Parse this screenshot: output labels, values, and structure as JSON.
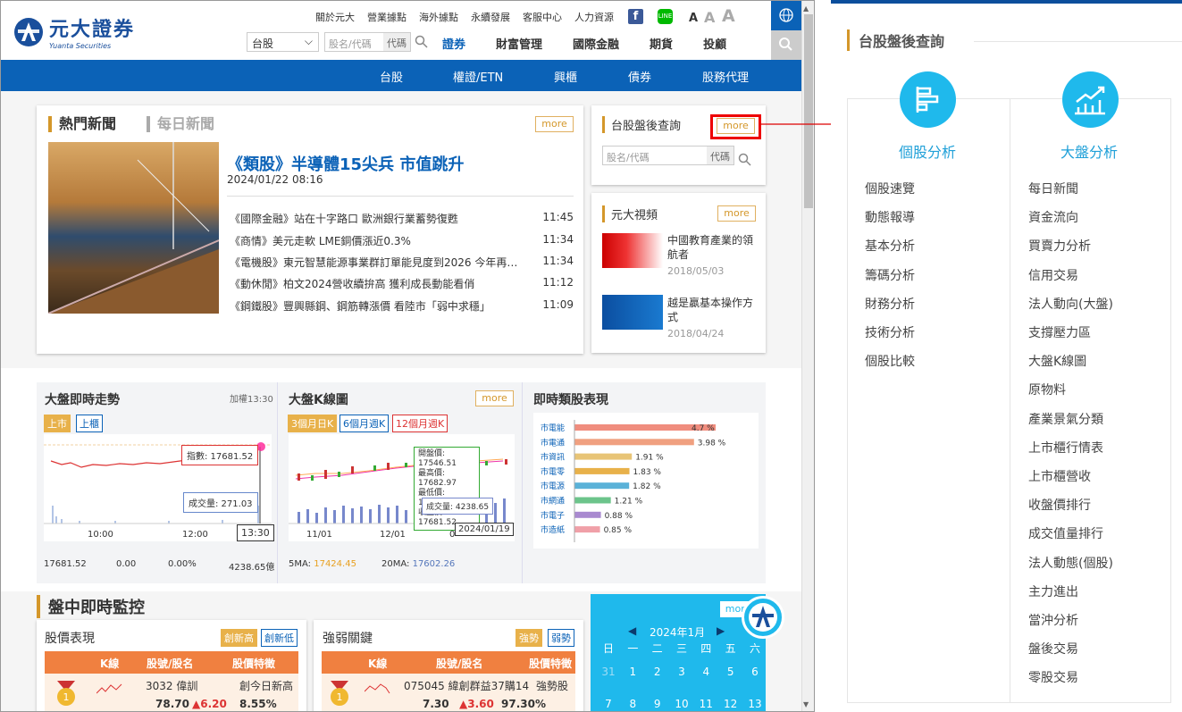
{
  "header": {
    "logo_cn": "元大證券",
    "logo_en": "Yuanta Securities",
    "top_links": [
      "關於元大",
      "營業據點",
      "海外據點",
      "永續發展",
      "客服中心",
      "人力資源"
    ],
    "font_sizes": [
      "A",
      "A",
      "A"
    ],
    "market_select": "台股",
    "search_placeholder": "股名/代碼",
    "search_code": "代碼",
    "main_nav": [
      "證券",
      "財富管理",
      "國際金融",
      "期貨",
      "投顧"
    ]
  },
  "subnav": [
    "台股",
    "權證/ETN",
    "興櫃",
    "債券",
    "股務代理"
  ],
  "news": {
    "tab_hot": "熱門新聞",
    "tab_daily": "每日新聞",
    "more": "more",
    "headline": "《類股》半導體15尖兵 市值跳升",
    "headline_date": "2024/01/22 08:16",
    "items": [
      {
        "t": "《國際金融》站在十字路口 歐洲銀行業蓄勢復甦",
        "time": "11:45"
      },
      {
        "t": "《商情》美元走軟 LME銅價漲近0.3%",
        "time": "11:34"
      },
      {
        "t": "《電機股》東元智慧能源事業群訂單能見度到2026 今年再…",
        "time": "11:34"
      },
      {
        "t": "《動休閒》柏文2024營收續拚高 獲利成長動能看俏",
        "time": "11:12"
      },
      {
        "t": "《鋼鐵股》豐興縣鋼、鋼筋轉漲價 看陸市「弱中求穩」",
        "time": "11:09"
      }
    ]
  },
  "after_hours": {
    "title": "台股盤後查詢",
    "more": "more",
    "placeholder": "股名/代碼",
    "code": "代碼"
  },
  "video": {
    "title": "元大視頻",
    "more": "more",
    "items": [
      {
        "t": "中國教育產業的領航者",
        "d": "2018/05/03"
      },
      {
        "t": "越是贏基本操作方式",
        "d": "2018/04/24"
      }
    ]
  },
  "market_trend": {
    "title": "大盤即時走勢",
    "time": "加權13:30",
    "tab1": "上市",
    "tab2": "上櫃",
    "index_label": "指數: 17681.52",
    "vol_label": "成交量: 271.03",
    "cursor_time": "13:30",
    "x1": "10:00",
    "x2": "12:00",
    "stats": [
      "17681.52",
      "0.00",
      "0.00%",
      "4238.65億"
    ]
  },
  "kline": {
    "title": "大盤K線圖",
    "more": "more",
    "tabs": [
      "3個月日K",
      "6個月週K",
      "12個月週K"
    ],
    "tip": [
      "開盤價: 17546.51",
      "最高價: 17682.97",
      "最低價: 17499.85",
      "收盤價: 17681.52"
    ],
    "vol": "成交量: 4238.65",
    "date": "2024/01/19",
    "x1": "11/01",
    "x2": "12/01",
    "x3": "0",
    "ma5_label": "5MA:",
    "ma5": "17424.45",
    "ma20_label": "20MA:",
    "ma20": "17602.26"
  },
  "sector": {
    "title": "即時類股表現",
    "chart_data": {
      "type": "bar",
      "categories": [
        "市電能",
        "市電通",
        "市資訊",
        "市電零",
        "市電源",
        "市網通",
        "市電子",
        "市造紙"
      ],
      "values": [
        4.7,
        3.98,
        1.91,
        1.83,
        1.82,
        1.21,
        0.88,
        0.85
      ],
      "labels": [
        "4.7 %",
        "3.98 %",
        "1.91 %",
        "1.83 %",
        "1.82 %",
        "1.21 %",
        "0.88 %",
        "0.85 %"
      ]
    }
  },
  "monitor": {
    "title": "盤中即時監控",
    "price": {
      "title": "股價表現",
      "t1": "創新高",
      "t2": "創新低",
      "cols": [
        "K線",
        "股號/股名",
        "股價特徵"
      ],
      "stock": "3032 偉訓",
      "feat": "創今日新高",
      "p": "78.70",
      "chg": "▲6.20",
      "pct": "8.55%"
    },
    "strong": {
      "title": "強弱關鍵",
      "t1": "強勢",
      "t2": "弱勢",
      "cols": [
        "K線",
        "股號/股名",
        "股價特徵"
      ],
      "stock": "075045 緯創群益37購14",
      "feat": "強勢股",
      "p": "7.30",
      "chg": "▲3.60",
      "pct": "97.30%"
    }
  },
  "calendar": {
    "more": "more",
    "month": "2024年1月",
    "days": [
      "日",
      "一",
      "二",
      "三",
      "四",
      "五",
      "六"
    ],
    "row1": [
      "31",
      "1",
      "2",
      "3",
      "4",
      "5",
      "6"
    ],
    "row2": [
      "7",
      "8",
      "9",
      "10",
      "11",
      "12",
      "13"
    ]
  },
  "panel": {
    "title": "台股盤後查詢",
    "col1": {
      "title": "個股分析",
      "items": [
        "個股速覽",
        "動態報導",
        "基本分析",
        "籌碼分析",
        "財務分析",
        "技術分析",
        "個股比較"
      ]
    },
    "col2": {
      "title": "大盤分析",
      "items": [
        "每日新聞",
        "資金流向",
        "買賣力分析",
        "信用交易",
        "法人動向(大盤)",
        "支撐壓力區",
        "大盤K線圖",
        "原物料",
        "產業景氣分類",
        "上市櫃行情表",
        "上市櫃營收",
        "收盤價排行",
        "成交值量排行",
        "法人動態(個股)",
        "主力進出",
        "當沖分析",
        "盤後交易",
        "零股交易"
      ]
    }
  }
}
